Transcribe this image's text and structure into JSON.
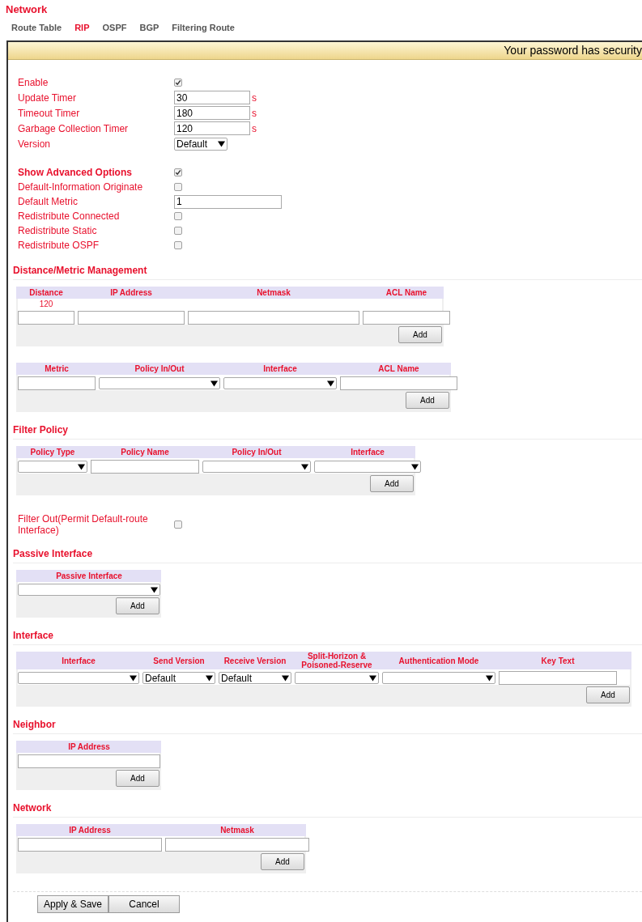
{
  "page_title": "Network",
  "tabs": [
    {
      "label": "Route Table",
      "selected": false
    },
    {
      "label": "RIP",
      "selected": true
    },
    {
      "label": "OSPF",
      "selected": false
    },
    {
      "label": "BGP",
      "selected": false
    },
    {
      "label": "Filtering Route",
      "selected": false
    }
  ],
  "banner": {
    "text": "Your password has security"
  },
  "settings": [
    {
      "label": "Enable",
      "kind": "checkbox",
      "checked": true
    },
    {
      "label": "Update Timer",
      "kind": "text",
      "value": "30",
      "unit": "s"
    },
    {
      "label": "Timeout Timer",
      "kind": "text",
      "value": "180",
      "unit": "s"
    },
    {
      "label": "Garbage Collection Timer",
      "kind": "text",
      "value": "120",
      "unit": "s"
    },
    {
      "label": "Version",
      "kind": "select",
      "value": "Default"
    }
  ],
  "advanced": {
    "label": "Show Advanced Options",
    "checked": true
  },
  "advanced_settings": [
    {
      "label": "Default-Information Originate",
      "kind": "checkbox",
      "checked": false
    },
    {
      "label": "Default Metric",
      "kind": "text",
      "value": "1"
    },
    {
      "label": "Redistribute Connected",
      "kind": "checkbox",
      "checked": false
    },
    {
      "label": "Redistribute Static",
      "kind": "checkbox",
      "checked": false
    },
    {
      "label": "Redistribute OSPF",
      "kind": "checkbox",
      "checked": false
    }
  ],
  "sections": [
    {
      "title": "Distance/Metric Management",
      "tables": [
        {
          "columns": [
            {
              "label": "Distance",
              "hint": "120"
            },
            {
              "label": "IP Address"
            },
            {
              "label": "Netmask"
            },
            {
              "label": "ACL Name"
            }
          ],
          "cells": [
            {
              "kind": "text"
            },
            {
              "kind": "text"
            },
            {
              "kind": "text"
            },
            {
              "kind": "text"
            }
          ],
          "button": "Add"
        },
        {
          "columns": [
            {
              "label": "Metric"
            },
            {
              "label": "Policy In/Out"
            },
            {
              "label": "Interface"
            },
            {
              "label": "ACL Name"
            }
          ],
          "cells": [
            {
              "kind": "text"
            },
            {
              "kind": "select"
            },
            {
              "kind": "select"
            },
            {
              "kind": "text"
            }
          ],
          "button": "Add"
        }
      ]
    },
    {
      "title": "Filter Policy",
      "tables": [
        {
          "columns": [
            {
              "label": "Policy Type"
            },
            {
              "label": "Policy Name"
            },
            {
              "label": "Policy In/Out"
            },
            {
              "label": "Interface"
            }
          ],
          "cells": [
            {
              "kind": "select"
            },
            {
              "kind": "text"
            },
            {
              "kind": "select"
            },
            {
              "kind": "select"
            }
          ],
          "button": "Add"
        }
      ],
      "settings": [
        {
          "label": "Filter Out(Permit Default-route Interface)",
          "kind": "checkbox",
          "checked": false
        }
      ]
    },
    {
      "title": "Passive Interface",
      "tables": [
        {
          "columns": [
            {
              "label": "Passive Interface"
            }
          ],
          "cells": [
            {
              "kind": "select"
            }
          ],
          "button": "Add"
        }
      ]
    },
    {
      "title": "Interface",
      "tables": [
        {
          "columns": [
            {
              "label": "Interface"
            },
            {
              "label": "Send Version"
            },
            {
              "label": "Receive Version"
            },
            {
              "label": "Split-Horizon & Poisoned-Reserve"
            },
            {
              "label": "Authentication Mode"
            },
            {
              "label": "Key Text"
            }
          ],
          "cells": [
            {
              "kind": "select"
            },
            {
              "kind": "select",
              "value": "Default"
            },
            {
              "kind": "select",
              "value": "Default"
            },
            {
              "kind": "select"
            },
            {
              "kind": "select"
            },
            {
              "kind": "text"
            }
          ],
          "button": "Add"
        }
      ]
    },
    {
      "title": "Neighbor",
      "tables": [
        {
          "columns": [
            {
              "label": "IP Address"
            }
          ],
          "cells": [
            {
              "kind": "text"
            }
          ],
          "button": "Add"
        }
      ]
    },
    {
      "title": "Network",
      "tables": [
        {
          "columns": [
            {
              "label": "IP Address"
            },
            {
              "label": "Netmask"
            }
          ],
          "cells": [
            {
              "kind": "text"
            },
            {
              "kind": "text"
            }
          ],
          "button": "Add"
        }
      ]
    }
  ],
  "actions": [
    "Apply & Save",
    "Cancel"
  ]
}
